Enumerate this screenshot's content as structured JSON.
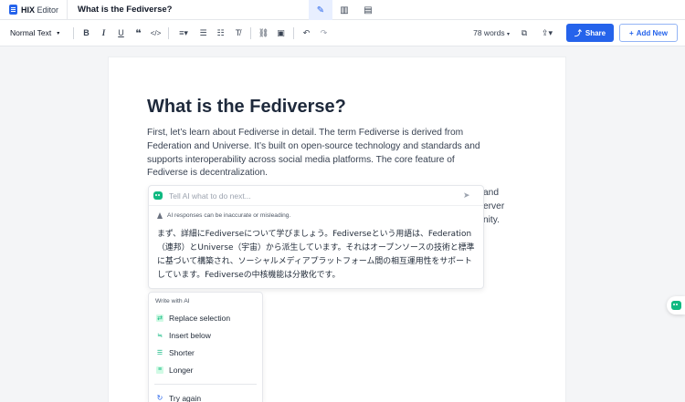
{
  "app": {
    "brand_bold": "HIX",
    "brand_light": " Editor",
    "document_title": "What is the Fediverse?"
  },
  "toolbar": {
    "text_style": "Normal Text",
    "word_count": "78 words",
    "share_label": "Share",
    "add_new_label": "Add New"
  },
  "document": {
    "heading": "What is the Fediverse?",
    "paragraph": "First, let’s learn about Fediverse in detail. The term Fediverse is derived from Federation and Universe. It’s built on open-source technology and standards and supports interoperability across social media platforms. The core feature of Fediverse is decentralization.",
    "obscured_tail_1": "and",
    "obscured_tail_2": "erver",
    "obscured_tail_3": "nity."
  },
  "ai_panel": {
    "input_placeholder": "Tell AI what to do next...",
    "warning": "AI responses can be inaccurate or misleading.",
    "response": "まず、詳細にFediverseについて学びましょう。Fediverseという用語は、Federation（連邦）とUniverse（宇宙）から派生しています。それはオープンソースの技術と標準に基づいて構築され、ソーシャルメディアプラットフォーム間の相互運用性をサポートしています。Fediverseの中核機能は分散化です。"
  },
  "write_menu": {
    "header": "Write with AI",
    "items": [
      {
        "label": "Replace selection",
        "icon": "replace-icon"
      },
      {
        "label": "Insert below",
        "icon": "insert-below-icon"
      },
      {
        "label": "Shorter",
        "icon": "shorter-icon"
      },
      {
        "label": "Longer",
        "icon": "longer-icon"
      }
    ],
    "try_again": "Try again"
  },
  "colors": {
    "accent_blue": "#2563eb",
    "ai_green": "#10b981"
  }
}
